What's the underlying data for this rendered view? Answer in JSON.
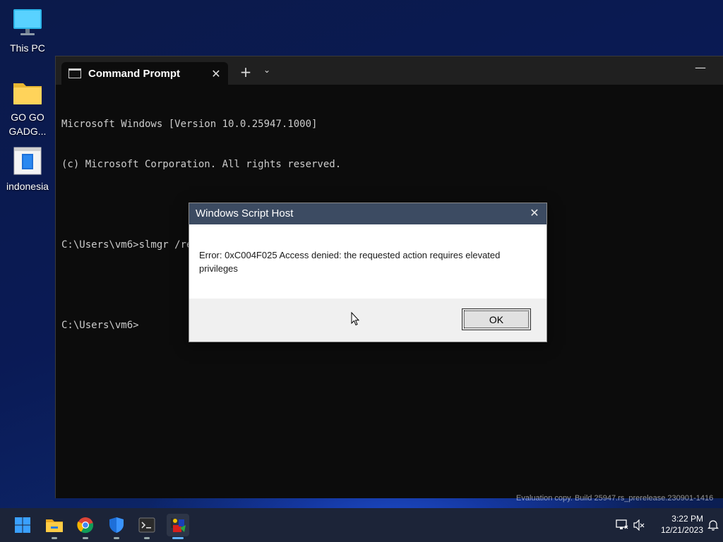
{
  "desktop": {
    "icons": [
      {
        "label": "This PC",
        "icon": "monitor-icon"
      },
      {
        "label": "GO GO\nGADG...",
        "icon": "folder-icon"
      },
      {
        "label": "indonesia",
        "icon": "document-icon"
      }
    ]
  },
  "terminal": {
    "tab_title": "Command Prompt",
    "tab_close": "✕",
    "new_tab": "+",
    "dropdown": "⌄",
    "minimize": "—",
    "lines": [
      "Microsoft Windows [Version 10.0.25947.1000]",
      "(c) Microsoft Corporation. All rights reserved.",
      "",
      "C:\\Users\\vm6>slmgr /rearm",
      "",
      "C:\\Users\\vm6>"
    ]
  },
  "dialog": {
    "title": "Windows Script Host",
    "close": "✕",
    "message": "Error: 0xC004F025 Access denied: the requested action requires elevated privileges",
    "ok_label": "OK"
  },
  "watermark": "Evaluation copy. Build 25947.rs_prerelease.230901-1416",
  "taskbar": {
    "apps": [
      {
        "name": "start",
        "icon": "windows-start-icon"
      },
      {
        "name": "file-explorer",
        "icon": "folder-icon"
      },
      {
        "name": "chrome",
        "icon": "chrome-icon"
      },
      {
        "name": "windows-security",
        "icon": "shield-icon"
      },
      {
        "name": "terminal",
        "icon": "terminal-icon"
      },
      {
        "name": "script-host",
        "icon": "script-icon"
      }
    ],
    "clock_time": "3:22 PM",
    "clock_date": "12/21/2023"
  },
  "colors": {
    "dialog_title_bg": "#3c4b62",
    "taskbar_bg": "#1c2438",
    "console_bg": "#0c0c0c"
  }
}
